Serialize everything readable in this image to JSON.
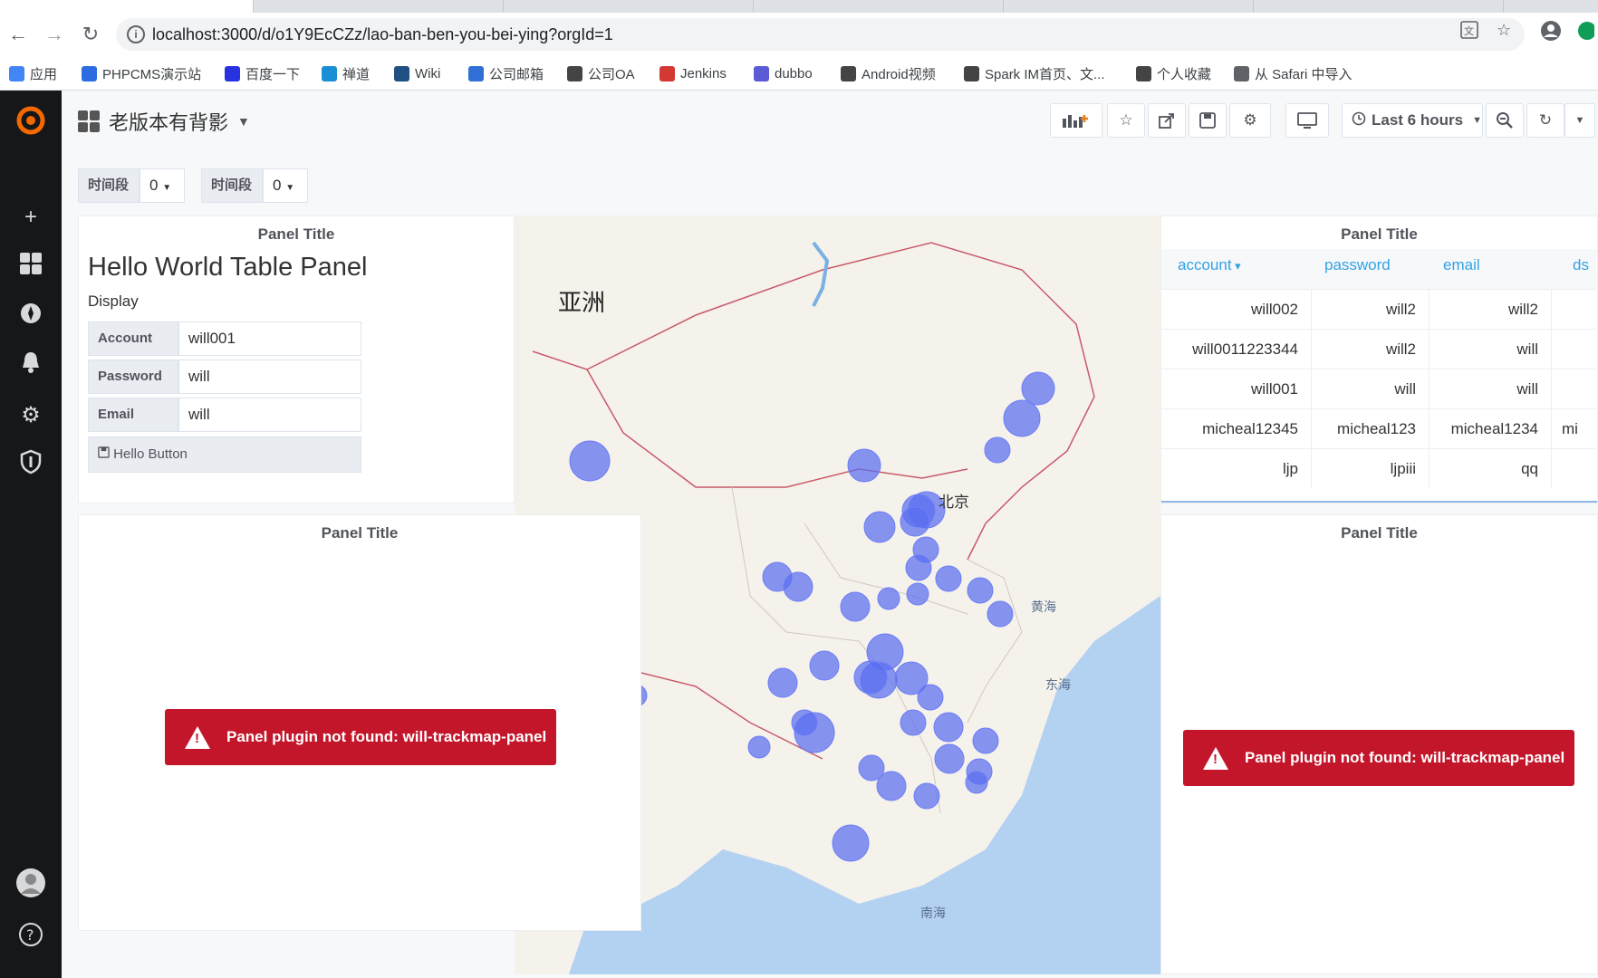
{
  "browser": {
    "url": "localhost:3000/d/o1Y9EcCZz/lao-ban-ben-you-bei-ying?orgId=1",
    "bookmarks": [
      {
        "label": "应用",
        "icon": "apps-grid-icon",
        "color": "#4285f4"
      },
      {
        "label": "PHPCMS演示站",
        "icon": "pc-icon",
        "color": "#2b6de0"
      },
      {
        "label": "百度一下",
        "icon": "baidu-paw-icon",
        "color": "#2932e1"
      },
      {
        "label": "禅道",
        "icon": "globe-icon",
        "color": "#1a8fd6"
      },
      {
        "label": "Wiki",
        "icon": "confluence-x-icon",
        "color": "#205081"
      },
      {
        "label": "公司邮箱",
        "icon": "c-icon",
        "color": "#2f6fd6"
      },
      {
        "label": "公司OA",
        "icon": "globe-icon",
        "color": "#444444"
      },
      {
        "label": "Jenkins",
        "icon": "jenkins-icon",
        "color": "#d33833"
      },
      {
        "label": "dubbo",
        "icon": "d-icon",
        "color": "#5b5bd6"
      },
      {
        "label": "Android视频",
        "icon": "globe-icon",
        "color": "#444444"
      },
      {
        "label": "Spark IM首页、文...",
        "icon": "globe-icon",
        "color": "#444444"
      },
      {
        "label": "个人收藏",
        "icon": "globe-icon",
        "color": "#444444"
      },
      {
        "label": "从 Safari 中导入",
        "icon": "folder-icon",
        "color": "#5f6368"
      }
    ]
  },
  "dashboard": {
    "title": "老版本有背影",
    "time_range": "Last 6 hours",
    "variables": [
      {
        "label": "时间段",
        "value": "0"
      },
      {
        "label": "时间段",
        "value": "0"
      }
    ]
  },
  "hello_panel": {
    "title": "Panel Title",
    "heading": "Hello World Table Panel",
    "subheading": "Display",
    "fields": [
      {
        "label": "Account",
        "value": "will001"
      },
      {
        "label": "Password",
        "value": "will"
      },
      {
        "label": "Email",
        "value": "will"
      }
    ],
    "button": "Hello Button"
  },
  "map_panel": {
    "continent_label": "亚洲",
    "labels": {
      "beijing": "北京",
      "yellow_sea": "黄海",
      "east_sea": "东海",
      "south_sea": "南海"
    }
  },
  "table_panel": {
    "title": "Panel Title",
    "columns": [
      "account",
      "password",
      "email",
      "ds"
    ],
    "sort_column": "account",
    "rows": [
      [
        "will002",
        "will2",
        "will2",
        ""
      ],
      [
        "will0011223344",
        "will2",
        "will",
        ""
      ],
      [
        "will001",
        "will",
        "will",
        ""
      ],
      [
        "micheal12345",
        "micheal123",
        "micheal1234",
        "mi"
      ],
      [
        "ljp",
        "ljpiii",
        "qq",
        ""
      ]
    ]
  },
  "trackmap_left": {
    "title": "Panel Title",
    "error": "Panel plugin not found: will-trackmap-panel"
  },
  "trackmap_right": {
    "title": "Panel Title",
    "error": "Panel plugin not found: will-trackmap-panel"
  },
  "colors": {
    "accent_link": "#33a2e5",
    "alert_red": "#c4162a",
    "bubble": "#5a6ef0",
    "sidebar": "#161719"
  }
}
